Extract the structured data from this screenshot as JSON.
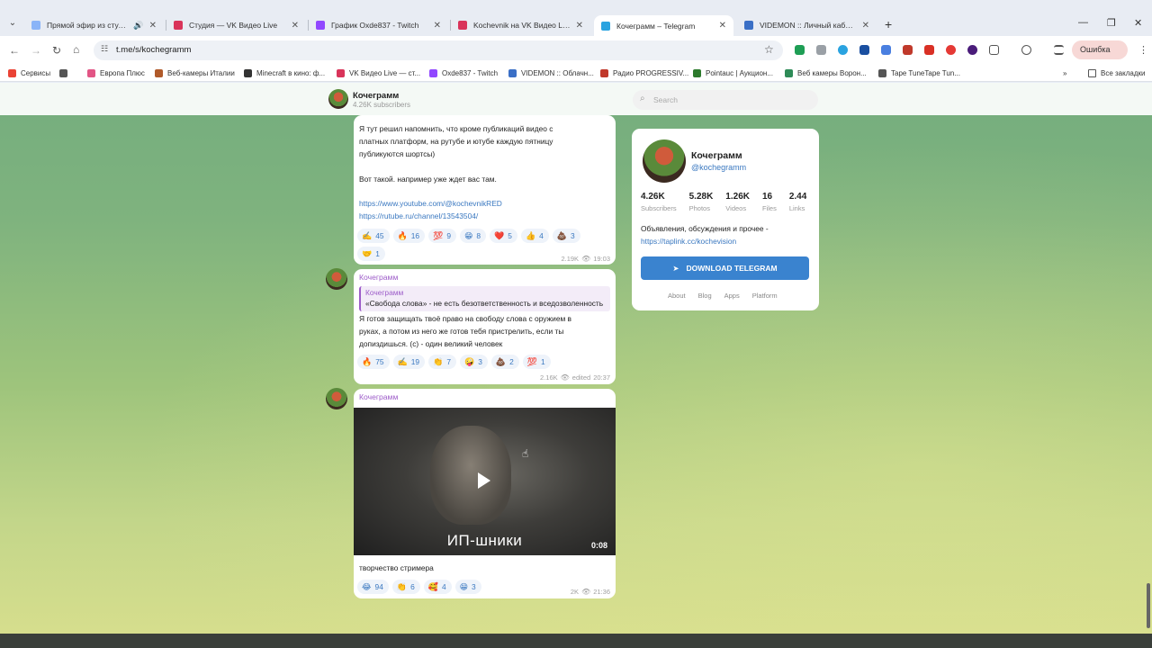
{
  "browser": {
    "tabs": [
      {
        "title": "Прямой эфир из студии «E",
        "fav": "#8ab4f8",
        "sound": true
      },
      {
        "title": "Студия — VK Видео Live",
        "fav": "#d9345a"
      },
      {
        "title": "График Oxde837 - Twitch",
        "fav": "#9147ff"
      },
      {
        "title": "Kochevnik на VK Видео Live – (",
        "fav": "#d9345a"
      },
      {
        "title": "Кочеграмм – Telegram",
        "fav": "#2aa3e0",
        "active": true
      },
      {
        "title": "VIDEMON :: Личный кабинет",
        "fav": "#3a6fc6"
      }
    ],
    "url": "t.me/s/kochegramm",
    "error_label": "Ошибка",
    "bookmarks": [
      {
        "label": "Сервисы",
        "color": "#ea4335"
      },
      {
        "label": "",
        "color": "#555555"
      },
      {
        "label": "Европа Плюс",
        "color": "#e25585"
      },
      {
        "label": "Веб-камеры Италии",
        "color": "#b05a2a"
      },
      {
        "label": "Minecraft в кино: ф...",
        "color": "#333333"
      },
      {
        "label": "VK Видео Live — ст...",
        "color": "#d9345a"
      },
      {
        "label": "Oxde837 - Twitch",
        "color": "#9147ff"
      },
      {
        "label": "VIDEMON :: Облачн...",
        "color": "#3a6fc6"
      },
      {
        "label": "Радио PROGRESSIV...",
        "color": "#c0392b"
      },
      {
        "label": "Pointauc | Аукцион...",
        "color": "#2c7a2c"
      },
      {
        "label": "Веб камеры Ворон...",
        "color": "#2e8b57"
      },
      {
        "label": "Tape TuneTape Tun...",
        "color": "#555555"
      }
    ],
    "all_bookmarks": "Все закладки"
  },
  "channel_header": {
    "title": "Кочеграмм",
    "subtitle": "4.26K subscribers",
    "search_placeholder": "Search"
  },
  "messages": [
    {
      "text": "Я тут решил напомнить, что кроме публикаций видео с\nплатных платформ, на рутубе и ютубе каждую пятницу\nпубликуются шортсы)\n\nВот такой. например уже ждет вас там.",
      "links": [
        "https://www.youtube.com/@kochevnikRED",
        "https://rutube.ru/channel/13543504/"
      ],
      "reactions": [
        {
          "emoji": "✍️",
          "count": "45"
        },
        {
          "emoji": "🔥",
          "count": "16"
        },
        {
          "emoji": "💯",
          "count": "9"
        },
        {
          "emoji": "😁",
          "count": "8"
        },
        {
          "emoji": "❤️",
          "count": "5"
        },
        {
          "emoji": "👍",
          "count": "4"
        },
        {
          "emoji": "💩",
          "count": "3"
        },
        {
          "emoji": "🤝",
          "count": "1"
        }
      ],
      "views": "2.19K",
      "time": "19:03"
    },
    {
      "author": "Кочеграмм",
      "quote_author": "Кочеграмм",
      "quote_text": "«Свобода слова» - не есть безответственность и вседозволенность",
      "text": "Я готов защищать твоё право на свободу слова с оружием в\nруках, а потом из него же готов тебя пристрелить, если ты\nдопиздишься. (с) - один великий человек",
      "reactions": [
        {
          "emoji": "🔥",
          "count": "75"
        },
        {
          "emoji": "✍️",
          "count": "19"
        },
        {
          "emoji": "👏",
          "count": "7"
        },
        {
          "emoji": "🤪",
          "count": "3"
        },
        {
          "emoji": "💩",
          "count": "2"
        },
        {
          "emoji": "💯",
          "count": "1"
        }
      ],
      "views": "2.16K",
      "edited": "edited",
      "time": "20:37"
    },
    {
      "author": "Кочеграмм",
      "video_caption": "ИП-шники",
      "video_duration": "0:08",
      "text": "творчество стримера",
      "reactions": [
        {
          "emoji": "😂",
          "count": "94"
        },
        {
          "emoji": "👏",
          "count": "6"
        },
        {
          "emoji": "🥰",
          "count": "4"
        },
        {
          "emoji": "😁",
          "count": "3"
        }
      ],
      "views": "2K",
      "time": "21:36"
    }
  ],
  "channel_card": {
    "name": "Кочеграмм",
    "handle": "@kochegramm",
    "stats": [
      {
        "value": "4.26K",
        "label": "Subscribers"
      },
      {
        "value": "5.28K",
        "label": "Photos"
      },
      {
        "value": "1.26K",
        "label": "Videos"
      },
      {
        "value": "16",
        "label": "Files"
      },
      {
        "value": "2.44",
        "label": "Links"
      }
    ],
    "description": "Объявления, обсуждения и прочее -",
    "link": "https://taplink.cc/kochevision",
    "download_label": "DOWNLOAD TELEGRAM",
    "footer_links": [
      "About",
      "Blog",
      "Apps",
      "Platform"
    ]
  }
}
